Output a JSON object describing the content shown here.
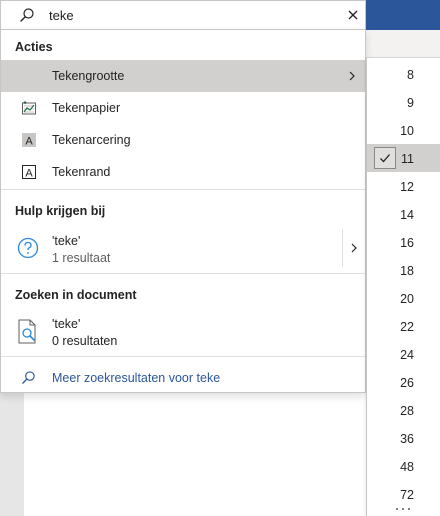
{
  "search": {
    "value": "teke",
    "icon": "search-icon",
    "clear_icon": "close-icon"
  },
  "actions": {
    "header": "Acties",
    "items": [
      {
        "label": "Tekengrootte",
        "icon": "font-size-icon",
        "submenu": true,
        "highlighted": true
      },
      {
        "label": "Tekenpapier",
        "icon": "drawing-paper-icon"
      },
      {
        "label": "Tekenarcering",
        "icon": "character-shading-icon"
      },
      {
        "label": "Tekenrand",
        "icon": "character-border-icon"
      }
    ]
  },
  "help": {
    "header": "Hulp krijgen bij",
    "result_title": "'teke'",
    "result_count": "1 resultaat",
    "icon": "help-circle-icon"
  },
  "document_search": {
    "header": "Zoeken in document",
    "result_title": "'teke'",
    "result_count": "0 resultaten",
    "icon": "document-search-icon"
  },
  "more_results": {
    "label": "Meer zoekresultaten voor teke",
    "icon": "search-icon"
  },
  "font_sizes": {
    "items": [
      "8",
      "9",
      "10",
      "11",
      "12",
      "14",
      "16",
      "18",
      "20",
      "22",
      "24",
      "26",
      "28",
      "36",
      "48",
      "72"
    ],
    "selected": "11"
  },
  "colors": {
    "accent": "#2b579a",
    "highlight": "#d2d0ce",
    "text": "#252423",
    "secondary_text": "#605e5c"
  }
}
